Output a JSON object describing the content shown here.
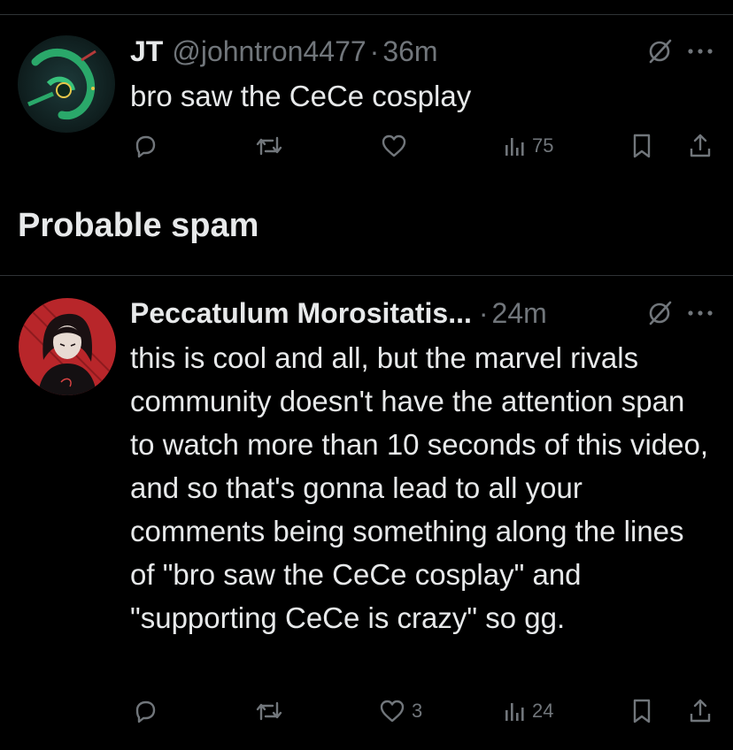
{
  "tweets": [
    {
      "name": "JT",
      "handle": "@johntron4477",
      "separator": "·",
      "time": "36m",
      "text": "bro saw the CeCe cosplay",
      "reply_count": "",
      "retweet_count": "",
      "like_count": "",
      "view_count": "75"
    },
    {
      "name": "Peccatulum Morositatis...",
      "handle": "",
      "separator": "·",
      "time": "24m",
      "text": "this is cool and all, but the marvel rivals community doesn't have the attention span to watch more than 10 seconds of this video, and so that's gonna lead to all your comments being something along the lines of \"bro saw the CeCe cosplay\" and \"supporting CeCe is crazy\" so gg.",
      "reply_count": "",
      "retweet_count": "",
      "like_count": "3",
      "view_count": "24"
    }
  ],
  "section": {
    "title": "Probable spam"
  },
  "icons": {
    "reply": "reply-icon",
    "retweet": "retweet-icon",
    "like": "heart-icon",
    "views": "views-chart-icon",
    "bookmark": "bookmark-icon",
    "share": "share-icon",
    "grok": "slash-circle-icon",
    "more": "more-icon"
  },
  "colors": {
    "background": "#000000",
    "text_primary": "#e7e9ea",
    "text_secondary": "#71767b",
    "divider": "#2f3336"
  }
}
